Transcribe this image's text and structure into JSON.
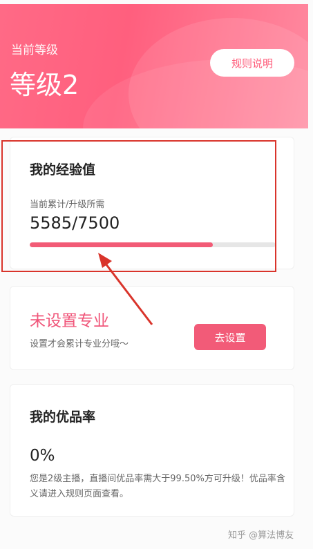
{
  "header": {
    "subtitle": "当前等级",
    "level": "等级2",
    "rules_button": "规则说明"
  },
  "experience": {
    "title": "我的经验值",
    "label": "当前累计/升级所需",
    "value": "5585/7500",
    "progress_fraction": 0.745
  },
  "major": {
    "title": "未设置专业",
    "description": "设置才会累计专业分哦～",
    "button": "去设置"
  },
  "quality": {
    "title": "我的优品率",
    "value": "0%",
    "note": "您是2级主播，直播间优品率需大于99.50%方可升级！优品率含义请进入规则页面查看。"
  },
  "watermark": "知乎 @算法博友",
  "colors": {
    "brand_pink": "#f25b76",
    "annotation_red": "#d9342b"
  }
}
